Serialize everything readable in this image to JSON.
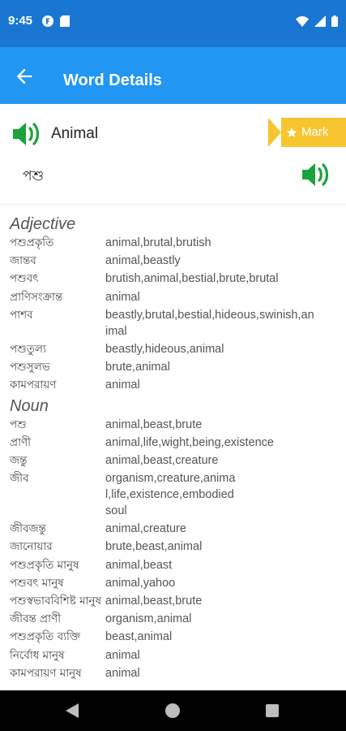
{
  "status_bar": {
    "time": "9:45"
  },
  "app_bar": {
    "title": "Word Details"
  },
  "word": {
    "english": "Animal",
    "bengali": "পশু",
    "mark_label": "Mark"
  },
  "colors": {
    "app_bar": "#2196f3",
    "status_bar": "#1976d2",
    "speaker": "#1aa33a",
    "mark": "#f6c530"
  },
  "sections": [
    {
      "pos": "Adjective",
      "entries": [
        {
          "bn": "পশুপ্রকৃতি",
          "en": [
            "animal,brutal,brutish"
          ]
        },
        {
          "bn": "জান্তব",
          "en": [
            "animal,beastly"
          ]
        },
        {
          "bn": "পশুবৎ",
          "en": [
            "brutish,animal,bestial,brute,brutal"
          ]
        },
        {
          "bn": "প্রাণিসংক্রান্ত",
          "en": [
            "animal"
          ]
        },
        {
          "bn": "পাশব",
          "en": [
            "beastly,brutal,bestial,hideous,swinish,an",
            "imal"
          ]
        },
        {
          "bn": "পশুতুল্য",
          "en": [
            "beastly,hideous,animal"
          ]
        },
        {
          "bn": "পশুসুলভ",
          "en": [
            "brute,animal"
          ]
        },
        {
          "bn": "কামপরায়ণ",
          "en": [
            "animal"
          ]
        }
      ]
    },
    {
      "pos": "Noun",
      "entries": [
        {
          "bn": "পশু",
          "en": [
            "animal,beast,brute"
          ]
        },
        {
          "bn": "প্রাণী",
          "en": [
            "animal,life,wight,being,existence"
          ]
        },
        {
          "bn": "জন্তু",
          "en": [
            "animal,beast,creature"
          ]
        },
        {
          "bn": "জীব",
          "en": [
            "organism,creature,anima",
            "l,life,existence,embodied",
            "soul"
          ]
        },
        {
          "bn": "জীবজন্তু",
          "en": [
            "animal,creature"
          ]
        },
        {
          "bn": "জানোয়ার",
          "en": [
            "brute,beast,animal"
          ]
        },
        {
          "bn": "পশুপ্রকৃতি মানুষ",
          "en": [
            "animal,beast"
          ]
        },
        {
          "bn": "পশুবৎ মানুষ",
          "en": [
            "animal,yahoo"
          ]
        },
        {
          "bn": "পশুস্বভাববিশিষ্ট মানুষ",
          "en": [
            "animal,beast,brute"
          ]
        },
        {
          "bn": "জীবন্ত প্রাণী",
          "en": [
            "organism,animal"
          ]
        },
        {
          "bn": "পশুপ্রকৃতি ব্যক্তি",
          "en": [
            "beast,animal"
          ]
        },
        {
          "bn": "নির্বোধ মানুষ",
          "en": [
            "animal"
          ]
        },
        {
          "bn": "কামপরায়ণ মানুষ",
          "en": [
            "animal"
          ]
        }
      ]
    }
  ]
}
